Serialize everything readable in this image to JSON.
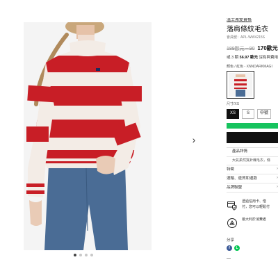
{
  "gallery": {
    "next_arrow": "›",
    "dot_count": 4,
    "active_dot": 0
  },
  "product": {
    "brand": "溫士弗愛寶格",
    "title": "落肩條紋毛衣",
    "sku": "會員號：APL-WW4215S",
    "price_old": "189歐元－90",
    "price_new": "170歐元",
    "installment_prefix": "或 3 期",
    "installment_amount": "56.97 歐元",
    "installment_suffix": "沒有與費用",
    "color_label": "顏色 / 紅色 - XNNDARKMAGI",
    "size_label": "尺寸/XS",
    "sizes": [
      "XS",
      "S",
      "中號"
    ],
    "selected_size": "XS"
  },
  "details": {
    "rows": [
      {
        "label": "產品詳情",
        "chevron": ""
      },
      {
        "label": "特徵",
        "chevron": "›"
      },
      {
        "label": "運輸、退貨和退款",
        "chevron": "›"
      },
      {
        "label": "品牌聯盟",
        "chevron": "›"
      }
    ],
    "description": "大氣柔然質針織毛衣，條"
  },
  "services": [
    {
      "icon": "security-shield-icon",
      "line1": "透過信用卡、借",
      "line2": "付，您可以輕鬆付"
    },
    {
      "icon": "recycle-bag-icon",
      "line1": "最大利於消費者",
      "line2": ""
    }
  ],
  "share": {
    "label": "分享",
    "facebook": "f",
    "line": "L"
  },
  "colors": {
    "accent_green": "#16c35e",
    "button_black": "#111111",
    "stripe_red": "#c81e26",
    "stripe_cream": "#f3ece6",
    "denim": "#4a6c95"
  }
}
